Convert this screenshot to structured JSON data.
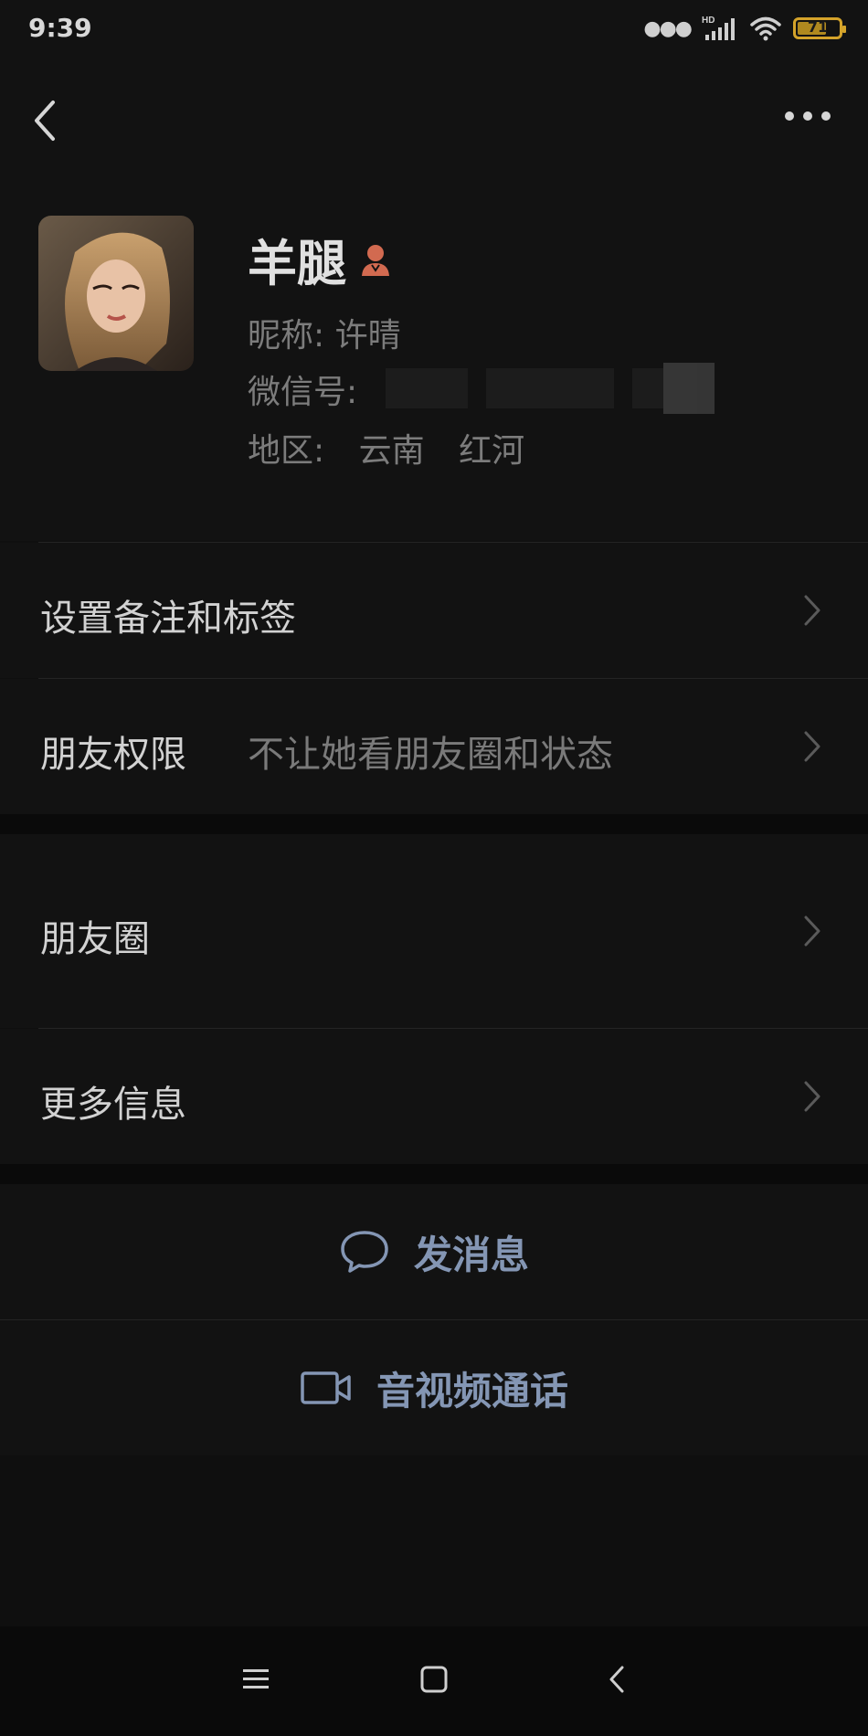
{
  "status_bar": {
    "time": "9:39",
    "network": "HD",
    "battery": "71",
    "battery_level": 0.71
  },
  "profile": {
    "name": "羊腿",
    "gender_icon": "female-icon",
    "nickname": "昵称: 许晴",
    "wechat_id_label": "微信号:",
    "region_label": "地区:",
    "region_province": "云南",
    "region_city": "红河"
  },
  "rows": {
    "remark": {
      "label": "设置备注和标签"
    },
    "permissions": {
      "label": "朋友权限",
      "value": "不让她看朋友圈和状态"
    },
    "moments": {
      "label": "朋友圈"
    },
    "more_info": {
      "label": "更多信息"
    }
  },
  "actions": {
    "message": {
      "label": "发消息",
      "icon": "chat-bubble-icon"
    },
    "call": {
      "label": "音视频通话",
      "icon": "video-camera-icon"
    }
  },
  "colors": {
    "background": "#121212",
    "accent_action": "#8496b4",
    "battery": "#d4a32a",
    "gender": "#d26a50"
  }
}
